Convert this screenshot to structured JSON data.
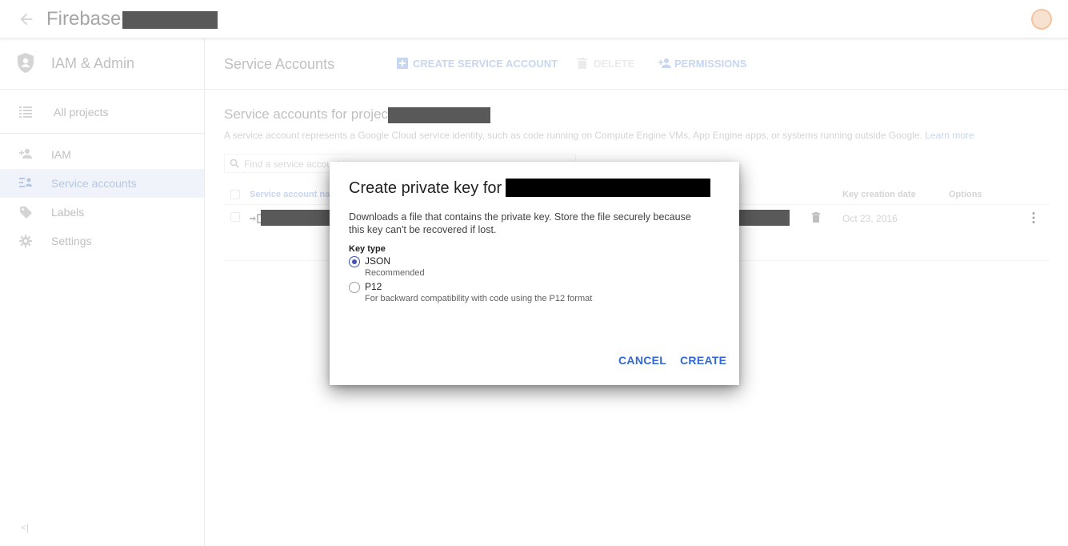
{
  "topbar": {
    "app_title": "Firebase"
  },
  "sidebar": {
    "title": "IAM & Admin",
    "all_projects": "All projects",
    "items": [
      {
        "label": "IAM",
        "icon": "person-add-icon"
      },
      {
        "label": "Service accounts",
        "icon": "service-account-icon",
        "active": true
      },
      {
        "label": "Labels",
        "icon": "label-icon"
      },
      {
        "label": "Settings",
        "icon": "gear-icon"
      }
    ],
    "collapse_label": "<|"
  },
  "main": {
    "heading": "Service Accounts",
    "toolbar": {
      "create_label": "CREATE SERVICE ACCOUNT",
      "delete_label": "DELETE",
      "permissions_label": "PERMISSIONS"
    },
    "section_title": "Service accounts for project",
    "section_desc": "A service account represents a Google Cloud service identity, such as code running on Compute Engine VMs, App Engine apps, or systems running outside Google.",
    "learn_more": "Learn more",
    "search_placeholder": "Find a service account",
    "table": {
      "headers": {
        "service_account": "Service account na",
        "key_creation": "Key creation date",
        "options": "Options"
      },
      "rows": [
        {
          "key_date": "Oct 23, 2016"
        }
      ]
    }
  },
  "dialog": {
    "title": "Create private key for",
    "description": "Downloads a file that contains the private key. Store the file securely because this key can't be recovered if lost.",
    "key_type_label": "Key type",
    "options": [
      {
        "label": "JSON",
        "sub": "Recommended",
        "checked": true
      },
      {
        "label": "P12",
        "sub": "For backward compatibility with code using the P12 format",
        "checked": false
      }
    ],
    "cancel_label": "CANCEL",
    "create_label": "CREATE"
  },
  "colors": {
    "accent": "#3367d6",
    "radio": "#3f51b5",
    "redaction": "#000000"
  }
}
